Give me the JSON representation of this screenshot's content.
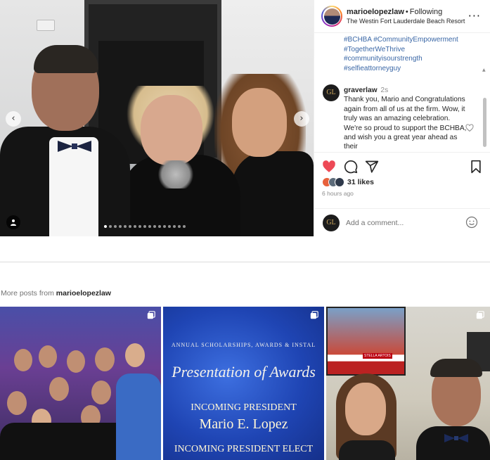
{
  "post": {
    "username": "marioelopezlaw",
    "separator": "•",
    "follow_status": "Following",
    "location": "The Westin Fort Lauderdale Beach Resort",
    "more_options": "···",
    "hashtags": [
      "#BCHBA #CommunityEmpowerment",
      "#TogetherWeThrive",
      "#communityisourstrength",
      "#selfieattorneyguy"
    ],
    "comment": {
      "username": "graverlaw",
      "time": "2s",
      "text": "Thank you, Mario and Congratulations again from all of us at the firm. Wow, it truly was an amazing celebration. We're so proud to support the BCHBA, and wish you a great year ahead as their"
    },
    "likes": "31 likes",
    "time_ago": "6 hours ago",
    "add_comment_placeholder": "Add a comment...",
    "carousel": {
      "total_slides": 17,
      "active_index": 0
    },
    "avatar_monogram": "GL"
  },
  "more_posts": {
    "prefix": "More posts from",
    "username": "marioelopezlaw",
    "thumbs": [
      {
        "kind": "gala-crowd"
      },
      {
        "kind": "award-slide",
        "line1": "ANNUAL SCHOLARSHIPS, AWARDS & INSTAL",
        "line2": "Presentation of Awards",
        "line3": "INCOMING PRESIDENT",
        "line4": "Mario E. Lopez",
        "line5": "INCOMING PRESIDENT ELECT"
      },
      {
        "kind": "selfie",
        "tv_label": "STELLA ARTOIS"
      }
    ]
  },
  "colors": {
    "like_red": "#ed4956",
    "hashtag_blue": "#3a67a6",
    "muted": "#8e8e8e"
  },
  "icons": [
    "chevron-left-icon",
    "chevron-right-icon",
    "user-tag-icon",
    "more-options-icon",
    "heart-icon",
    "comment-icon",
    "share-icon",
    "bookmark-icon",
    "emoji-icon",
    "multi-photo-icon"
  ]
}
